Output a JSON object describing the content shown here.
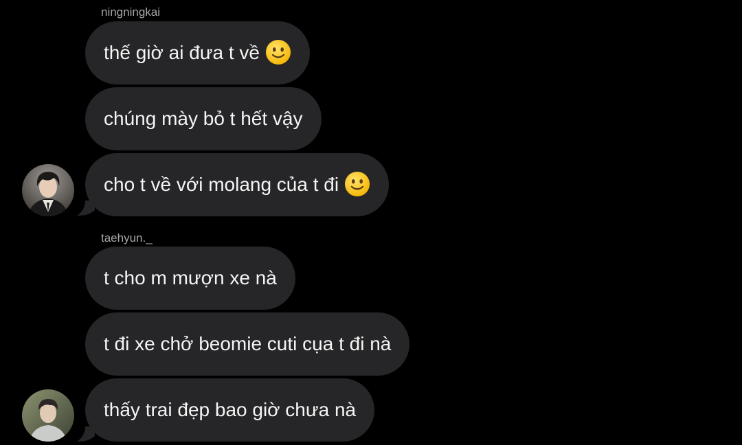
{
  "thread": {
    "groups": [
      {
        "sender": "ningningkai",
        "messages": [
          {
            "text": "thế giờ ai đưa t về",
            "emoji": "slightly-smiling-face"
          },
          {
            "text": "chúng mày bỏ t hết vậy"
          },
          {
            "text": "cho t về với molang của t đi",
            "emoji": "slightly-smiling-face"
          }
        ]
      },
      {
        "sender": "taehyun._",
        "messages": [
          {
            "text": "t cho m mượn xe nà"
          },
          {
            "text": "t đi xe chở beomie cuti cụa t đi nà"
          },
          {
            "text": "thấy trai đẹp bao giờ chưa nà"
          }
        ]
      }
    ]
  },
  "colors": {
    "background": "#000000",
    "bubble": "#262628",
    "text": "#f5f5f5",
    "sender_name": "#a8a8a8"
  }
}
